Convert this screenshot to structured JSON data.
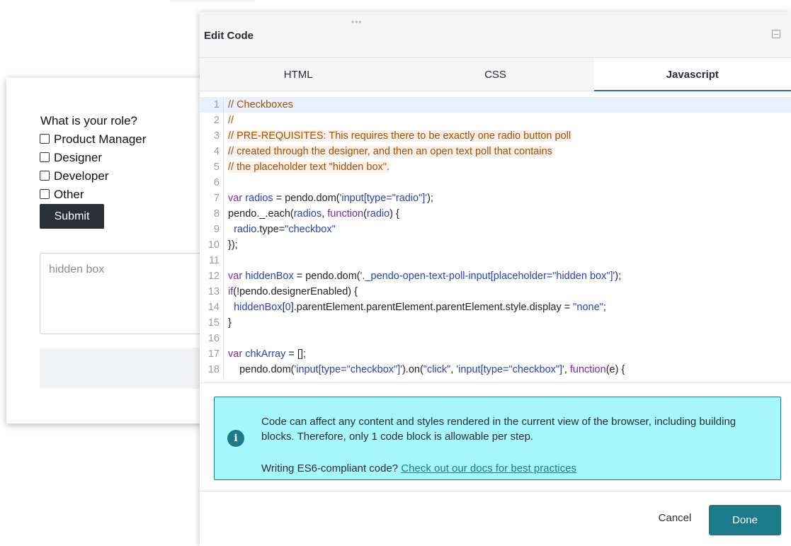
{
  "poll": {
    "question": "What is your role?",
    "options": [
      "Product Manager",
      "Designer",
      "Developer",
      "Other"
    ],
    "submit_label": "Submit",
    "textbox_placeholder": "hidden box"
  },
  "modal": {
    "title": "Edit Code",
    "tabs": [
      "HTML",
      "CSS",
      "Javascript"
    ],
    "active_tab": "Javascript",
    "code_lines": [
      "// Checkboxes",
      "//",
      "// PRE-REQUISITES: This requires there to be exactly one radio button poll",
      "// created through the designer, and then an open text poll that contains",
      "// the placeholder text \"hidden box\".",
      "",
      "var radios = pendo.dom('input[type=\"radio\"]');",
      "pendo._.each(radios, function(radio) {",
      "  radio.type=\"checkbox\"",
      "});",
      "",
      "var hiddenBox = pendo.dom('._pendo-open-text-poll-input[placeholder=\"hidden box\"]');",
      "if(!pendo.designerEnabled) {",
      "  hiddenBox[0].parentElement.parentElement.parentElement.style.display = \"none\";",
      "}",
      "",
      "var chkArray = [];",
      "    pendo.dom('input[type=\"checkbox\"]').on(\"click\", 'input[type=\"checkbox\"]', function(e) {"
    ],
    "info": {
      "message": "Code can affect any content and styles rendered in the current view of the browser, including building blocks. Therefore, only 1 code block is allowable per step.",
      "es6_prompt": "Writing ES6-compliant code?",
      "docs_link": "Check out our docs for best practices"
    },
    "cancel_label": "Cancel",
    "done_label": "Done"
  },
  "colors": {
    "accent": "#1c7a89",
    "info_bg": "#a6f7fb",
    "comment": "#a64f00",
    "keyword": "#7a2ba4",
    "variable": "#2842b8"
  }
}
